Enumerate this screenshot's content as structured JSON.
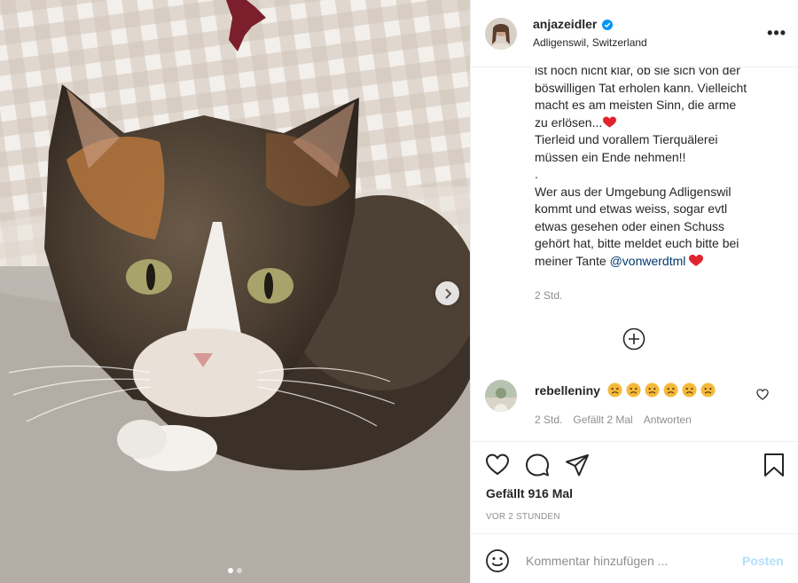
{
  "header": {
    "username": "anjazeidler",
    "location": "Adligenswil, Switzerland",
    "more_label": "•••"
  },
  "caption": {
    "lines": [
      "ist noch nicht klar, ob sie sich von der",
      "böswilligen Tat erholen kann. Vielleicht",
      "macht es am meisten Sinn, die arme",
      "zu erlösen...",
      "Tierleid und vorallem Tierquälerei",
      "müssen ein Ende nehmen!!",
      ".",
      "Wer aus der Umgebung Adligenswil",
      "kommt und etwas weiss, sogar evtl",
      "etwas gesehen oder einen Schuss",
      "gehört hat, bitte meldet euch bitte bei",
      "meiner Tante"
    ],
    "mention": "@vonwerdtml",
    "time": "2 Std."
  },
  "comment": {
    "username": "rebelleniny",
    "emoji_count": 6,
    "time": "2 Std.",
    "likes": "Gefällt 2 Mal",
    "reply": "Antworten"
  },
  "likes_text": "Gefällt 916 Mal",
  "posted_ago": "VOR 2 STUNDEN",
  "add_comment": {
    "placeholder": "Kommentar hinzufügen ...",
    "post_label": "Posten"
  },
  "carousel": {
    "current": 1,
    "total": 2
  },
  "colors": {
    "verified": "#0095f6",
    "heart_red": "#ed4956",
    "mention": "#00376b",
    "post_button": "#b2dffc",
    "muted_text": "#8e8e8e"
  }
}
